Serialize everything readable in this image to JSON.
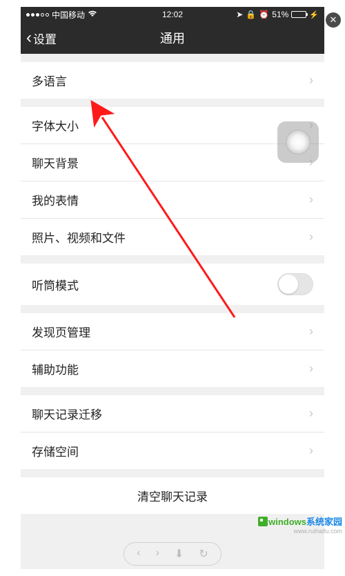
{
  "status_bar": {
    "carrier": "中国移动",
    "time": "12:02",
    "battery_pct": "51%"
  },
  "nav": {
    "back_label": "设置",
    "title": "通用"
  },
  "groups": [
    {
      "cells": [
        {
          "label": "多语言",
          "type": "disclose"
        }
      ]
    },
    {
      "cells": [
        {
          "label": "字体大小",
          "type": "disclose"
        },
        {
          "label": "聊天背景",
          "type": "disclose"
        },
        {
          "label": "我的表情",
          "type": "disclose"
        },
        {
          "label": "照片、视频和文件",
          "type": "disclose"
        }
      ]
    },
    {
      "cells": [
        {
          "label": "听筒模式",
          "type": "switch",
          "value": false
        }
      ]
    },
    {
      "cells": [
        {
          "label": "发现页管理",
          "type": "disclose"
        },
        {
          "label": "辅助功能",
          "type": "disclose"
        }
      ]
    },
    {
      "cells": [
        {
          "label": "聊天记录迁移",
          "type": "disclose"
        },
        {
          "label": "存储空间",
          "type": "disclose"
        }
      ]
    },
    {
      "cells": [
        {
          "label": "清空聊天记录",
          "type": "button"
        }
      ]
    }
  ],
  "watermark": {
    "brand_a": "windows",
    "brand_b": "系统家园",
    "url": "www.ruihaifu.com"
  }
}
